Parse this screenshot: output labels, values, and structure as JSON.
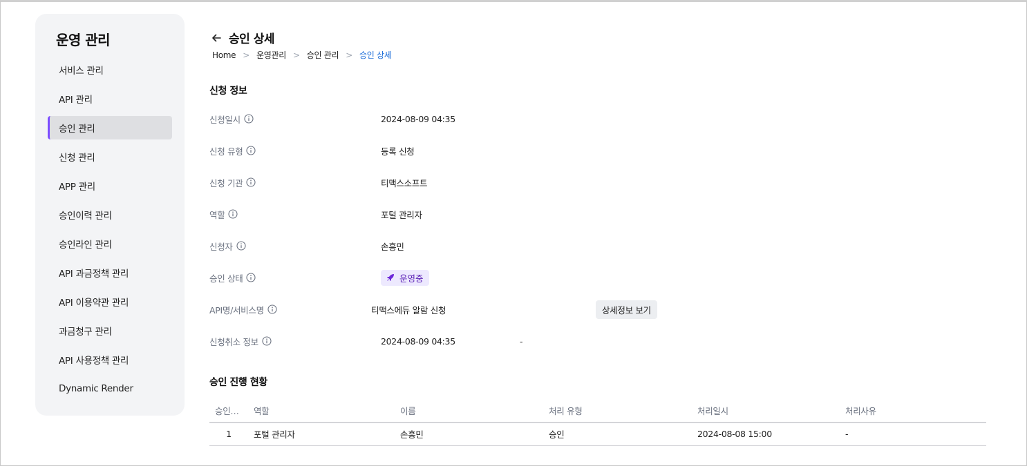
{
  "sidebar": {
    "title": "운영 관리",
    "items": [
      {
        "label": "서비스 관리"
      },
      {
        "label": "API 관리"
      },
      {
        "label": "승인 관리",
        "active": true
      },
      {
        "label": "신청 관리"
      },
      {
        "label": "APP 관리"
      },
      {
        "label": "승인이력 관리"
      },
      {
        "label": "승인라인 관리"
      },
      {
        "label": "API 과금정책 관리"
      },
      {
        "label": "API 이용약관 관리"
      },
      {
        "label": "과금청구 관리"
      },
      {
        "label": "API 사용정책 관리"
      },
      {
        "label": "Dynamic Render"
      }
    ],
    "accent_color": "#7c4dff"
  },
  "header": {
    "back_icon": "arrow-left-icon",
    "title": "승인 상세",
    "breadcrumb": [
      "Home",
      "운영관리",
      "승인 관리",
      "승인 상세"
    ]
  },
  "request_info": {
    "section_title": "신청 정보",
    "rows": [
      {
        "label": "신청일시",
        "value": "2024-08-09 04:35"
      },
      {
        "label": "신청 유형",
        "value": "등록 신청"
      },
      {
        "label": "신청 기관",
        "value": "티맥스소프트"
      },
      {
        "label": "역할",
        "value": "포털 관리자"
      },
      {
        "label": "신청자",
        "value": "손흥민"
      },
      {
        "label": "승인 상태",
        "value": "운영중",
        "icon": "rocket-icon"
      },
      {
        "label": "API명/서비스명",
        "value": "티맥스에듀 알람 신청",
        "button": "상세정보 보기"
      },
      {
        "label": "신청취소 정보",
        "value": "2024-08-09 04:35",
        "extra": "-"
      }
    ]
  },
  "progress": {
    "section_title": "승인 진행 현황",
    "columns": [
      "승인…",
      "역할",
      "이름",
      "처리 유형",
      "처리일시",
      "처리사유"
    ],
    "rows": [
      [
        "1",
        "포털 관리자",
        "손흥민",
        "승인",
        "2024-08-08 15:00",
        "-"
      ]
    ]
  },
  "colors": {
    "badge_bg": "#ede9fe",
    "badge_text": "#5b21b6",
    "breadcrumb_current": "#1e6fd9"
  }
}
